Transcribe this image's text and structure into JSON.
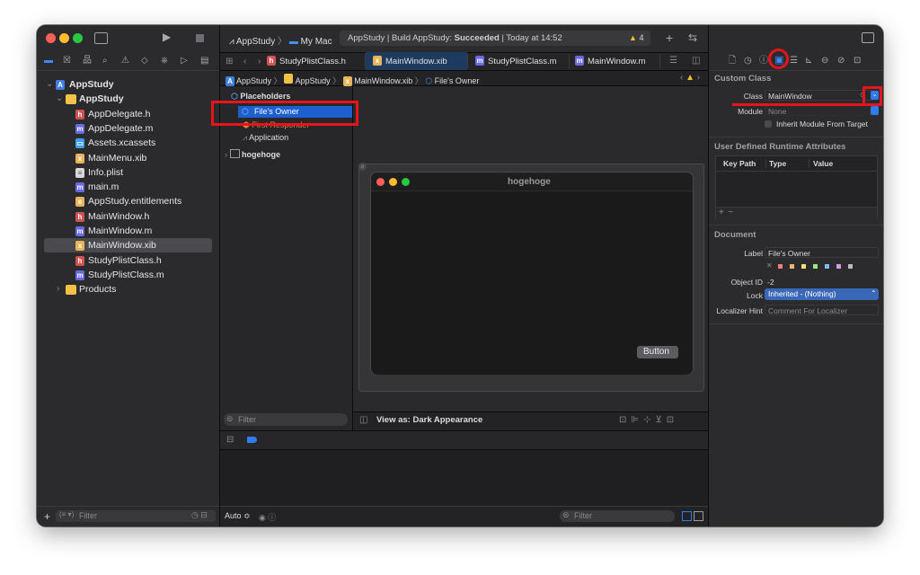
{
  "toolbar": {
    "scheme": "AppStudy",
    "destination": "My Mac",
    "status_prefix": "AppStudy | Build AppStudy: ",
    "status_result": "Succeeded",
    "status_time": " | Today at 14:52",
    "warning_count": "4"
  },
  "tabs": [
    {
      "label": "StudyPlistClass.h",
      "badge": "h"
    },
    {
      "label": "MainWindow.xib",
      "badge": "x"
    },
    {
      "label": "StudyPlistClass.m",
      "badge": "m"
    },
    {
      "label": "MainWindow.m",
      "badge": "m"
    }
  ],
  "navigator": {
    "items": [
      {
        "label": "AppStudy",
        "type": "project"
      },
      {
        "label": "AppStudy",
        "type": "folder"
      },
      {
        "label": "AppDelegate.h",
        "type": "h"
      },
      {
        "label": "AppDelegate.m",
        "type": "m"
      },
      {
        "label": "Assets.xcassets",
        "type": "assets"
      },
      {
        "label": "MainMenu.xib",
        "type": "xib"
      },
      {
        "label": "Info.plist",
        "type": "plist"
      },
      {
        "label": "main.m",
        "type": "m"
      },
      {
        "label": "AppStudy.entitlements",
        "type": "ent"
      },
      {
        "label": "MainWindow.h",
        "type": "h"
      },
      {
        "label": "MainWindow.m",
        "type": "m"
      },
      {
        "label": "MainWindow.xib",
        "type": "xib"
      },
      {
        "label": "StudyPlistClass.h",
        "type": "h"
      },
      {
        "label": "StudyPlistClass.m",
        "type": "m"
      },
      {
        "label": "Products",
        "type": "folder"
      }
    ],
    "filter_placeholder": "Filter"
  },
  "breadcrumb": [
    "AppStudy",
    "AppStudy",
    "MainWindow.xib",
    "File's Owner"
  ],
  "outline": {
    "placeholders_label": "Placeholders",
    "files_owner": "File's Owner",
    "first_responder": "First Responder",
    "application": "Application",
    "window_item": "hogehoge",
    "filter_placeholder": "Filter"
  },
  "canvas": {
    "window_title": "hogehoge",
    "button_label": "Button",
    "view_as": "View as: Dark Appearance",
    "auto_label": "Auto ≎",
    "filter_placeholder": "Filter"
  },
  "inspector": {
    "custom_class_title": "Custom Class",
    "class_label": "Class",
    "class_value": "MainWindow",
    "module_label": "Module",
    "module_value": "None",
    "inherit_label": "Inherit Module From Target",
    "runtime_title": "User Defined Runtime Attributes",
    "col_keypath": "Key Path",
    "col_type": "Type",
    "col_value": "Value",
    "document_title": "Document",
    "label_label": "Label",
    "label_value": "File's Owner",
    "object_id_label": "Object ID",
    "object_id_value": "-2",
    "lock_label": "Lock",
    "lock_value": "Inherited - (Nothing)",
    "localizer_label": "Localizer Hint",
    "localizer_placeholder": "Comment For Localizer"
  },
  "colors": {
    "accent": "#0a64d6",
    "annotation_red": "#e8141b",
    "label_colors": [
      "#f27e7e",
      "#f5b46b",
      "#f2e36b",
      "#a6e07c",
      "#7fb5f2",
      "#d49ae6",
      "#bdbdbd"
    ]
  }
}
